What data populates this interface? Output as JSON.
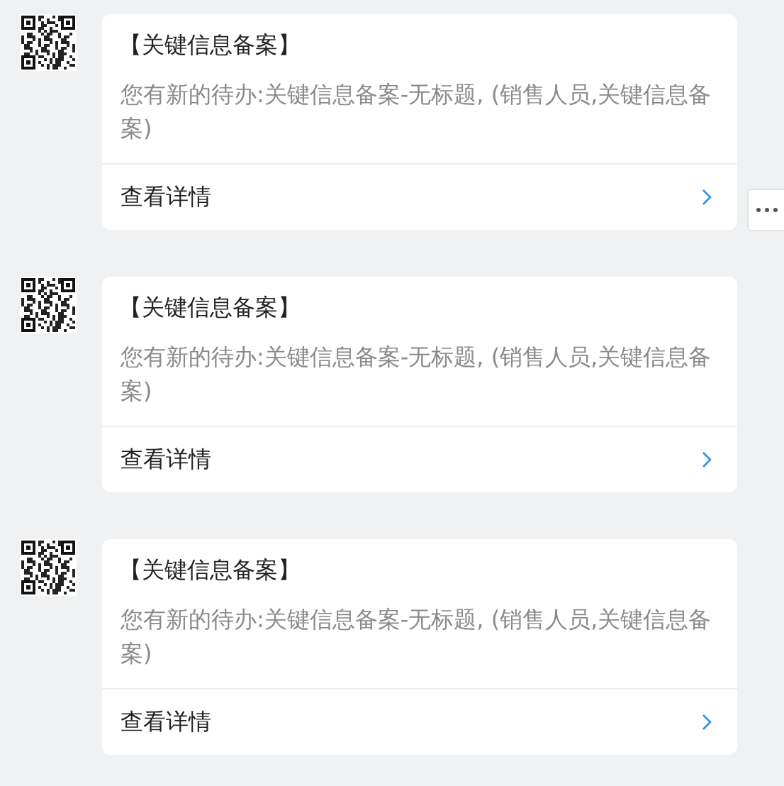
{
  "messages": [
    {
      "title": "【关键信息备案】",
      "body": "您有新的待办:关键信息备案-无标题, (销售人员,关键信息备案)",
      "action": "查看详情"
    },
    {
      "title": "【关键信息备案】",
      "body": "您有新的待办:关键信息备案-无标题, (销售人员,关键信息备案)",
      "action": "查看详情"
    },
    {
      "title": "【关键信息备案】",
      "body": "您有新的待办:关键信息备案-无标题, (销售人员,关键信息备案)",
      "action": "查看详情"
    }
  ]
}
